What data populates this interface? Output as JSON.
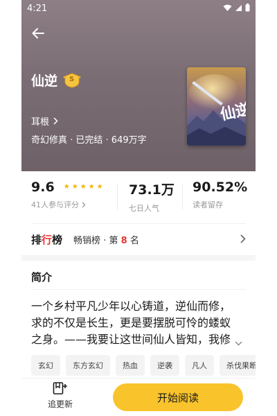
{
  "status_bar": {
    "time": "4:21",
    "icons": [
      "wifi-icon",
      "signal-icon",
      "battery-icon"
    ]
  },
  "header": {
    "back_icon": "arrow-left-icon"
  },
  "book": {
    "title": "仙逆",
    "badge_letter": "S",
    "author": "耳根",
    "meta": "奇幻修真 · 已完结 · 649万字",
    "cover_title": "仙逆"
  },
  "stats": {
    "rating": "9.6",
    "rating_stars": 5,
    "rating_sub": "41人参与评分",
    "popularity": "73.1万",
    "popularity_sub": "七日人气",
    "retention": "90.52%",
    "retention_sub": "读者留存"
  },
  "ranking": {
    "tag_part1": "排",
    "tag_part2": "行",
    "tag_part3": "榜",
    "list_name": "畅销榜",
    "dot": "·",
    "rank_prefix": "第",
    "rank_number": "8",
    "rank_suffix": "名"
  },
  "intro": {
    "heading": "简介",
    "text": "一个乡村平凡少年以心铸道，逆仙而修，求的不仅是长生，更是要摆脱可怜的蝼蚁之身。——我要让这世间仙人皆知，我修才"
  },
  "tags": [
    "玄幻",
    "东方玄幻",
    "热血",
    "逆袭",
    "凡人",
    "杀伐果断"
  ],
  "bottom_bar": {
    "follow_label": "追更新",
    "read_label": "开始阅读"
  },
  "colors": {
    "hero_bg": "#7b6d74",
    "accent_yellow": "#f9c32b",
    "star": "#f5b400",
    "rank_red": "#e53935"
  }
}
